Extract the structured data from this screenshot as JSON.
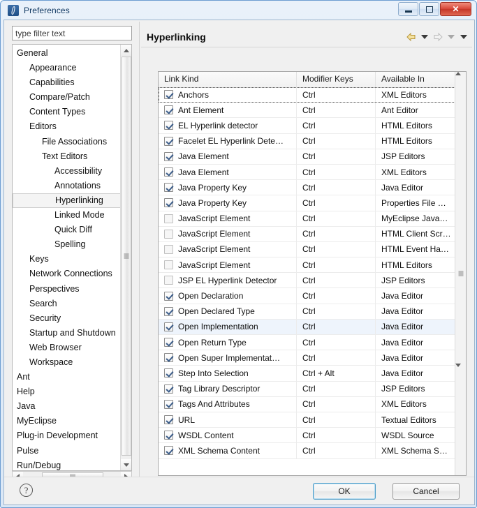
{
  "window": {
    "title": "Preferences",
    "app_icon": "eclipse-preferences-icon",
    "controls": {
      "minimize": "minimize-icon",
      "maximize": "maximize-icon",
      "close": "✕"
    }
  },
  "sidebar": {
    "filter": {
      "value": "",
      "placeholder": "type filter text"
    },
    "items": [
      {
        "label": "General",
        "level": 1,
        "selected": false
      },
      {
        "label": "Appearance",
        "level": 2,
        "selected": false
      },
      {
        "label": "Capabilities",
        "level": 2,
        "selected": false
      },
      {
        "label": "Compare/Patch",
        "level": 2,
        "selected": false
      },
      {
        "label": "Content Types",
        "level": 2,
        "selected": false
      },
      {
        "label": "Editors",
        "level": 2,
        "selected": false
      },
      {
        "label": "File Associations",
        "level": 3,
        "selected": false
      },
      {
        "label": "Text Editors",
        "level": 3,
        "selected": false
      },
      {
        "label": "Accessibility",
        "level": 4,
        "selected": false
      },
      {
        "label": "Annotations",
        "level": 4,
        "selected": false
      },
      {
        "label": "Hyperlinking",
        "level": 4,
        "selected": true
      },
      {
        "label": "Linked Mode",
        "level": 4,
        "selected": false
      },
      {
        "label": "Quick Diff",
        "level": 4,
        "selected": false
      },
      {
        "label": "Spelling",
        "level": 4,
        "selected": false
      },
      {
        "label": "Keys",
        "level": 2,
        "selected": false
      },
      {
        "label": "Network Connections",
        "level": 2,
        "selected": false
      },
      {
        "label": "Perspectives",
        "level": 2,
        "selected": false
      },
      {
        "label": "Search",
        "level": 2,
        "selected": false
      },
      {
        "label": "Security",
        "level": 2,
        "selected": false
      },
      {
        "label": "Startup and Shutdown",
        "level": 2,
        "selected": false
      },
      {
        "label": "Web Browser",
        "level": 2,
        "selected": false
      },
      {
        "label": "Workspace",
        "level": 2,
        "selected": false
      },
      {
        "label": "Ant",
        "level": 1,
        "selected": false
      },
      {
        "label": "Help",
        "level": 1,
        "selected": false
      },
      {
        "label": "Java",
        "level": 1,
        "selected": false
      },
      {
        "label": "MyEclipse",
        "level": 1,
        "selected": false
      },
      {
        "label": "Plug-in Development",
        "level": 1,
        "selected": false
      },
      {
        "label": "Pulse",
        "level": 1,
        "selected": false
      },
      {
        "label": "Run/Debug",
        "level": 1,
        "selected": false
      }
    ]
  },
  "page": {
    "title": "Hyperlinking",
    "nav": {
      "back": "back-arrow-icon",
      "back_menu": "back-dropdown-icon",
      "forward": "forward-arrow-icon",
      "forward_menu": "forward-dropdown-icon",
      "view_menu": "view-menu-icon"
    }
  },
  "table": {
    "columns": [
      "Link Kind",
      "Modifier Keys",
      "Available In"
    ],
    "rows": [
      {
        "checked": true,
        "enabled": true,
        "kind": "Anchors",
        "modifier": "Ctrl",
        "available": "XML Editors",
        "state": "focus"
      },
      {
        "checked": true,
        "enabled": true,
        "kind": "Ant Element",
        "modifier": "Ctrl",
        "available": "Ant Editor",
        "state": ""
      },
      {
        "checked": true,
        "enabled": true,
        "kind": "EL Hyperlink detector",
        "modifier": "Ctrl",
        "available": "HTML Editors",
        "state": ""
      },
      {
        "checked": true,
        "enabled": true,
        "kind": "Facelet EL Hyperlink Dete…",
        "modifier": "Ctrl",
        "available": "HTML Editors",
        "state": ""
      },
      {
        "checked": true,
        "enabled": true,
        "kind": "Java Element",
        "modifier": "Ctrl",
        "available": "JSP Editors",
        "state": ""
      },
      {
        "checked": true,
        "enabled": true,
        "kind": "Java Element",
        "modifier": "Ctrl",
        "available": "XML Editors",
        "state": ""
      },
      {
        "checked": true,
        "enabled": true,
        "kind": "Java Property Key",
        "modifier": "Ctrl",
        "available": "Java Editor",
        "state": ""
      },
      {
        "checked": true,
        "enabled": true,
        "kind": "Java Property Key",
        "modifier": "Ctrl",
        "available": "Properties File …",
        "state": ""
      },
      {
        "checked": false,
        "enabled": false,
        "kind": "JavaScript Element",
        "modifier": "Ctrl",
        "available": "MyEclipse Java…",
        "state": ""
      },
      {
        "checked": false,
        "enabled": false,
        "kind": "JavaScript Element",
        "modifier": "Ctrl",
        "available": "HTML Client Scr…",
        "state": ""
      },
      {
        "checked": false,
        "enabled": false,
        "kind": "JavaScript Element",
        "modifier": "Ctrl",
        "available": "HTML Event Ha…",
        "state": ""
      },
      {
        "checked": false,
        "enabled": false,
        "kind": "JavaScript Element",
        "modifier": "Ctrl",
        "available": "HTML Editors",
        "state": ""
      },
      {
        "checked": false,
        "enabled": false,
        "kind": "JSP EL Hyperlink Detector",
        "modifier": "Ctrl",
        "available": "JSP Editors",
        "state": ""
      },
      {
        "checked": true,
        "enabled": true,
        "kind": "Open Declaration",
        "modifier": "Ctrl",
        "available": "Java Editor",
        "state": ""
      },
      {
        "checked": true,
        "enabled": true,
        "kind": "Open Declared Type",
        "modifier": "Ctrl",
        "available": "Java Editor",
        "state": ""
      },
      {
        "checked": true,
        "enabled": true,
        "kind": "Open Implementation",
        "modifier": "Ctrl",
        "available": "Java Editor",
        "state": "hover"
      },
      {
        "checked": true,
        "enabled": true,
        "kind": "Open Return Type",
        "modifier": "Ctrl",
        "available": "Java Editor",
        "state": ""
      },
      {
        "checked": true,
        "enabled": true,
        "kind": "Open Super Implementat…",
        "modifier": "Ctrl",
        "available": "Java Editor",
        "state": ""
      },
      {
        "checked": true,
        "enabled": true,
        "kind": "Step Into Selection",
        "modifier": "Ctrl + Alt",
        "available": "Java Editor",
        "state": ""
      },
      {
        "checked": true,
        "enabled": true,
        "kind": "Tag Library Descriptor",
        "modifier": "Ctrl",
        "available": "JSP Editors",
        "state": ""
      },
      {
        "checked": true,
        "enabled": true,
        "kind": "Tags And Attributes",
        "modifier": "Ctrl",
        "available": "XML Editors",
        "state": ""
      },
      {
        "checked": true,
        "enabled": true,
        "kind": "URL",
        "modifier": "Ctrl",
        "available": "Textual Editors",
        "state": ""
      },
      {
        "checked": true,
        "enabled": true,
        "kind": "WSDL Content",
        "modifier": "Ctrl",
        "available": "WSDL Source",
        "state": ""
      },
      {
        "checked": true,
        "enabled": true,
        "kind": "XML Schema Content",
        "modifier": "Ctrl",
        "available": "XML Schema S…",
        "state": ""
      }
    ]
  },
  "footer": {
    "help": "?",
    "ok_label": "OK",
    "cancel_label": "Cancel"
  }
}
